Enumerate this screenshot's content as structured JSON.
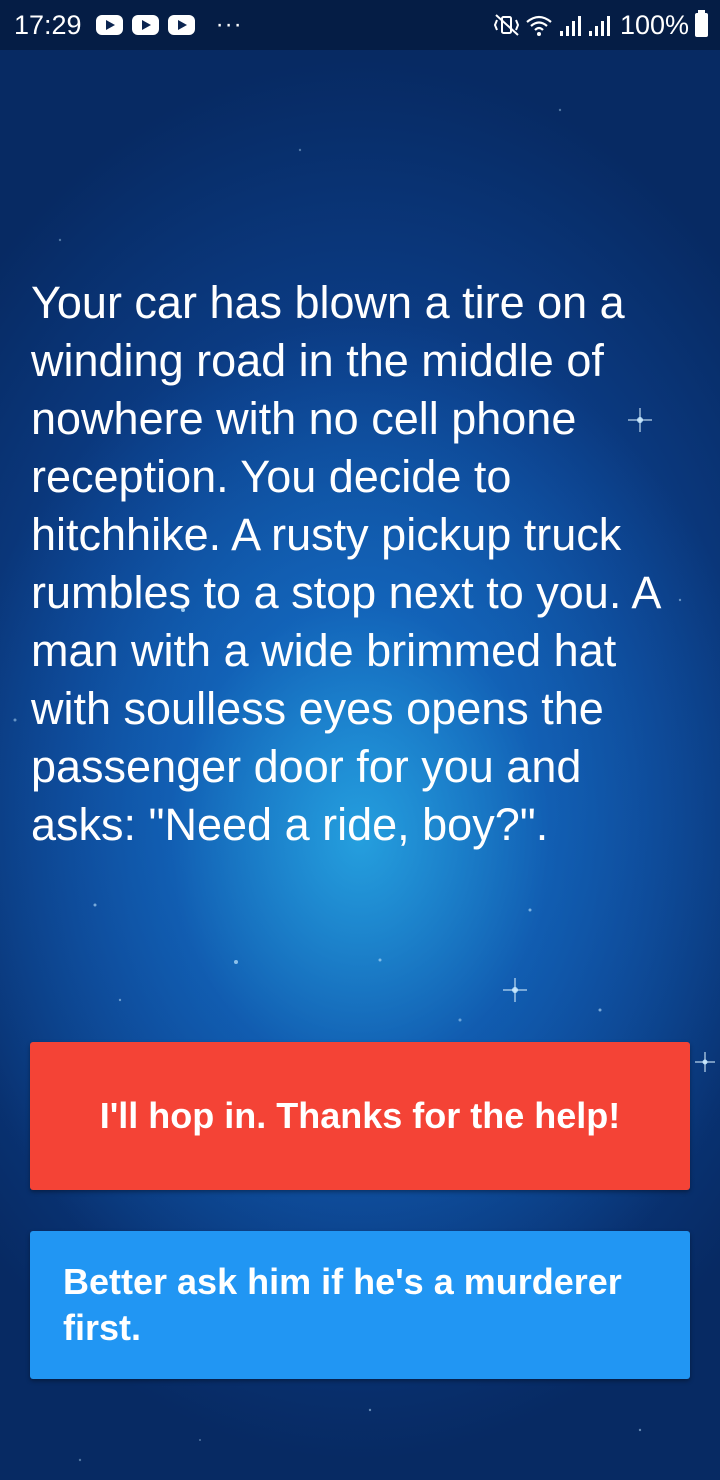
{
  "status_bar": {
    "time": "17:29",
    "notification_icons": [
      "youtube-icon",
      "youtube-icon",
      "youtube-icon"
    ],
    "more": "···",
    "battery": "100%",
    "icons": [
      "mute-vibrate-icon",
      "wifi-icon",
      "signal-icon",
      "signal-icon",
      "battery-icon"
    ]
  },
  "story": {
    "text": "Your car has blown a tire on a winding road in the middle of nowhere with no cell phone reception. You decide to hitchhike. A rusty pickup truck rumbles to a stop next to you. A man with a wide brimmed hat with soulless eyes opens the passenger door for you and asks: \"Need a ride, boy?\"."
  },
  "choices": [
    {
      "label": "I'll hop in. Thanks for the help!",
      "color": "#f44336"
    },
    {
      "label": "Better ask him if he's a murderer first.",
      "color": "#2196f3"
    }
  ],
  "background": {
    "colors": [
      "#072a63",
      "#1466b8",
      "#28aae6"
    ]
  }
}
